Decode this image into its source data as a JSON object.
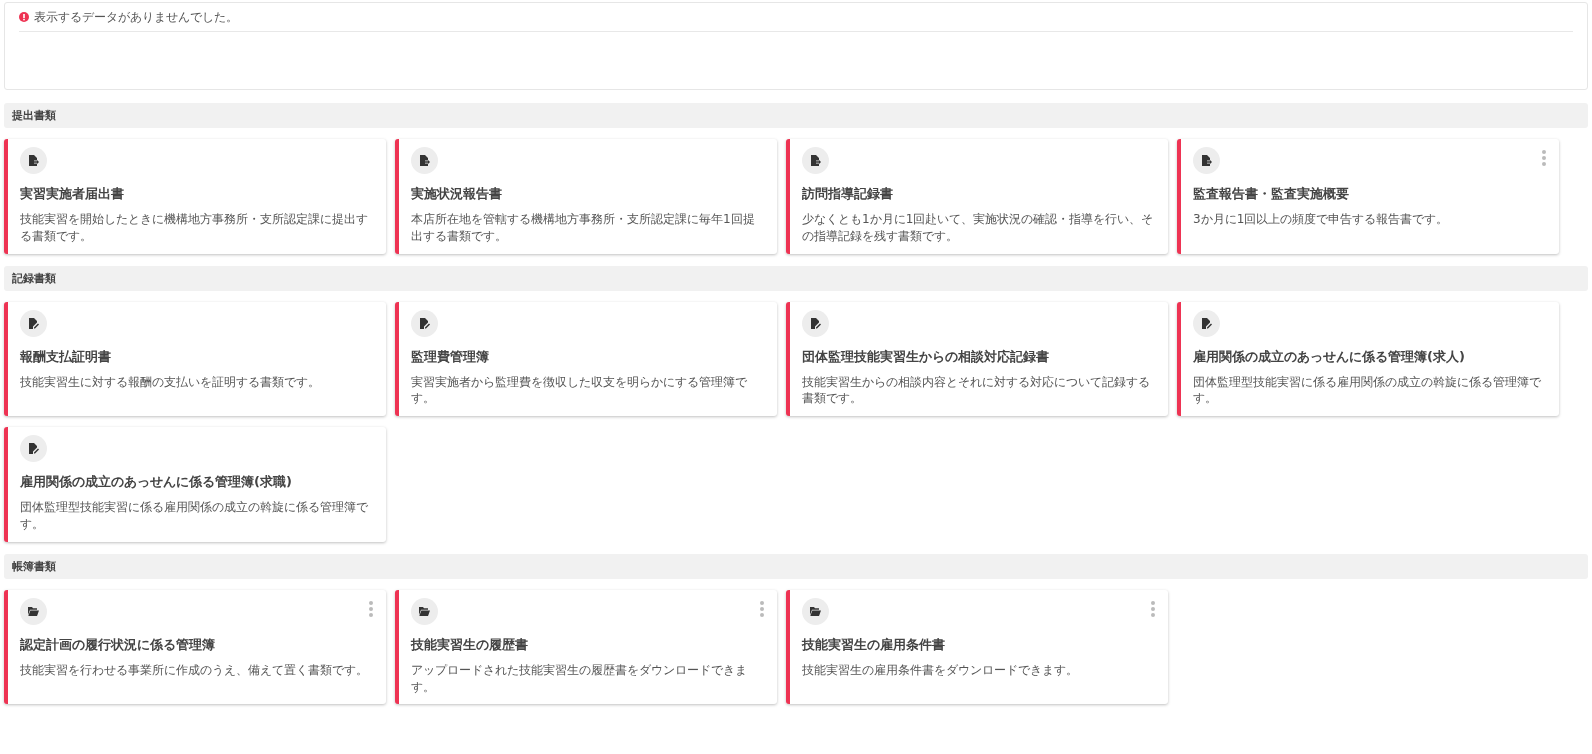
{
  "notice": {
    "kind": "error",
    "message": "表示するデータがありませんでした。"
  },
  "sections": [
    {
      "title": "提出書類",
      "cards": [
        {
          "kind": "submit",
          "menu": false,
          "title": "実習実施者届出書",
          "description": "技能実習を開始したときに機構地方事務所・支所認定課に提出する書類です。"
        },
        {
          "kind": "submit",
          "menu": false,
          "title": "実施状況報告書",
          "description": "本店所在地を管轄する機構地方事務所・支所認定課に毎年1回提出する書類です。"
        },
        {
          "kind": "submit",
          "menu": false,
          "title": "訪問指導記録書",
          "description": "少なくとも1か月に1回赴いて、実施状況の確認・指導を行い、その指導記録を残す書類です。"
        },
        {
          "kind": "submit",
          "menu": true,
          "title": "監査報告書・監査実施概要",
          "description": "3か月に1回以上の頻度で申告する報告書です。"
        }
      ]
    },
    {
      "title": "記録書類",
      "cards": [
        {
          "kind": "record",
          "menu": false,
          "title": "報酬支払証明書",
          "description": "技能実習生に対する報酬の支払いを証明する書類です。"
        },
        {
          "kind": "record",
          "menu": false,
          "title": "監理費管理簿",
          "description": "実習実施者から監理費を徴収した収支を明らかにする管理簿です。"
        },
        {
          "kind": "record",
          "menu": false,
          "title": "団体監理技能実習生からの相談対応記録書",
          "description": "技能実習生からの相談内容とそれに対する対応について記録する書類です。"
        },
        {
          "kind": "record",
          "menu": false,
          "title": "雇用関係の成立のあっせんに係る管理簿(求人)",
          "description": "団体監理型技能実習に係る雇用関係の成立の斡旋に係る管理簿です。"
        },
        {
          "kind": "record",
          "menu": false,
          "title": "雇用関係の成立のあっせんに係る管理簿(求職)",
          "description": "団体監理型技能実習に係る雇用関係の成立の斡旋に係る管理簿です。"
        }
      ]
    },
    {
      "title": "帳簿書類",
      "cards": [
        {
          "kind": "folder",
          "menu": true,
          "title": "認定計画の履行状況に係る管理簿",
          "description": "技能実習を行わせる事業所に作成のうえ、備えて置く書類です。"
        },
        {
          "kind": "folder",
          "menu": true,
          "title": "技能実習生の履歴書",
          "description": "アップロードされた技能実習生の履歴書をダウンロードできます。"
        },
        {
          "kind": "folder",
          "menu": true,
          "title": "技能実習生の雇用条件書",
          "description": "技能実習生の雇用条件書をダウンロードできます。"
        }
      ]
    }
  ]
}
